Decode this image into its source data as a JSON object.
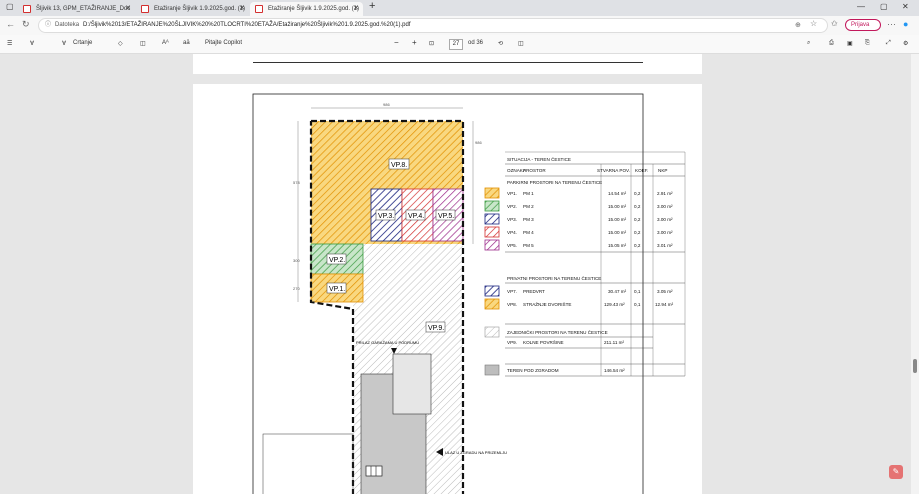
{
  "tabs": [
    {
      "title": "Šljivik 13, GPM_ETAŽIRANJE_Doc",
      "active": false
    },
    {
      "title": "Etažiranje Šljivik 1.9.2025.god. (1)",
      "active": false
    },
    {
      "title": "Etažiranje Šljivik 1.9.2025.god. (1)",
      "active": true
    }
  ],
  "address": {
    "label": "Datoteka",
    "url": "D:/Šljivik%2013/ETAŽIRANJE%20ŠLJIVIK%20%20TLOCRTI%20ETAŽA/Etažiranje%20Šljivik%201.9.2025.god.%20(1).pdf",
    "signin": "Prijava"
  },
  "pdf_toolbar": {
    "draw_label": "Crtanje",
    "copilot": "Pitajte Copilot",
    "page": "27",
    "of_pages": "od 36",
    "zoom_out": "−",
    "zoom_in": "+"
  },
  "drawing": {
    "dim_top": "986",
    "dim_right": "986",
    "dim_left_1": "578",
    "dim_left_2": "300",
    "dim_left_3": "270",
    "labels": [
      "VP.8.",
      "VP.3.",
      "VP.4.",
      "VP.5.",
      "VP.2.",
      "VP.1.",
      "VP.9."
    ],
    "dims_small": [
      "300",
      "300",
      "300",
      "500",
      "500",
      "500"
    ],
    "note_garage": "PRILAZ GARAŽAMA U PODRUMU",
    "note_entrance": "ULAZ U ZGRADU NA PRIZEMLJU"
  },
  "table": {
    "title": "SITUACIJA - TEREN ČESTICE",
    "headers": [
      "OZNAKA",
      "PROSTOR",
      "STVARNA POV.",
      "KOEF.",
      "NKP"
    ],
    "section_parking": "PARKIRNI PROSTORI NA TERENU ČESTICE",
    "parking_rows": [
      {
        "code": "VP1.",
        "name": "PM 1",
        "area": "14.54 m²",
        "koef": "0,2",
        "nkp": "2.91 m²",
        "color": "#e8a020"
      },
      {
        "code": "VP2.",
        "name": "PM 2",
        "area": "15.00 m²",
        "koef": "0,2",
        "nkp": "3.00 m²",
        "color": "#4caf50"
      },
      {
        "code": "VP3.",
        "name": "PM 3",
        "area": "15.00 m²",
        "koef": "0,2",
        "nkp": "3.00 m²",
        "color": "#1a237e"
      },
      {
        "code": "VP4.",
        "name": "PM 4",
        "area": "15.00 m²",
        "koef": "0,2",
        "nkp": "3.00 m²",
        "color": "#d32f2f"
      },
      {
        "code": "VP5.",
        "name": "PM 5",
        "area": "15.05 m²",
        "koef": "0,2",
        "nkp": "3.01 m²",
        "color": "#9c2a8a"
      }
    ],
    "section_private": "PRIVATNI PROSTORI NA TERENU ČESTICE",
    "private_rows": [
      {
        "code": "VP7.",
        "name": "PREDVRT",
        "area": "30.47 m²",
        "koef": "0,1",
        "nkp": "3.05 m²",
        "color": "#1a237e"
      },
      {
        "code": "VP8.",
        "name": "STRAŽNJE DVORIŠTE",
        "area": "129.43 m²",
        "koef": "0,1",
        "nkp": "12.94 m²",
        "color": "#e8a020"
      }
    ],
    "section_common": "ZAJEDNIČKI PROSTORI NA TERENU ČESTICE",
    "common_rows": [
      {
        "code": "VP9.",
        "name": "KOLNE POVRŠINE",
        "area": "211.11 m²",
        "koef": "",
        "nkp": ""
      }
    ],
    "under_building": {
      "name": "TEREN POD ZGRADOM",
      "area": "146.54 m²"
    }
  }
}
